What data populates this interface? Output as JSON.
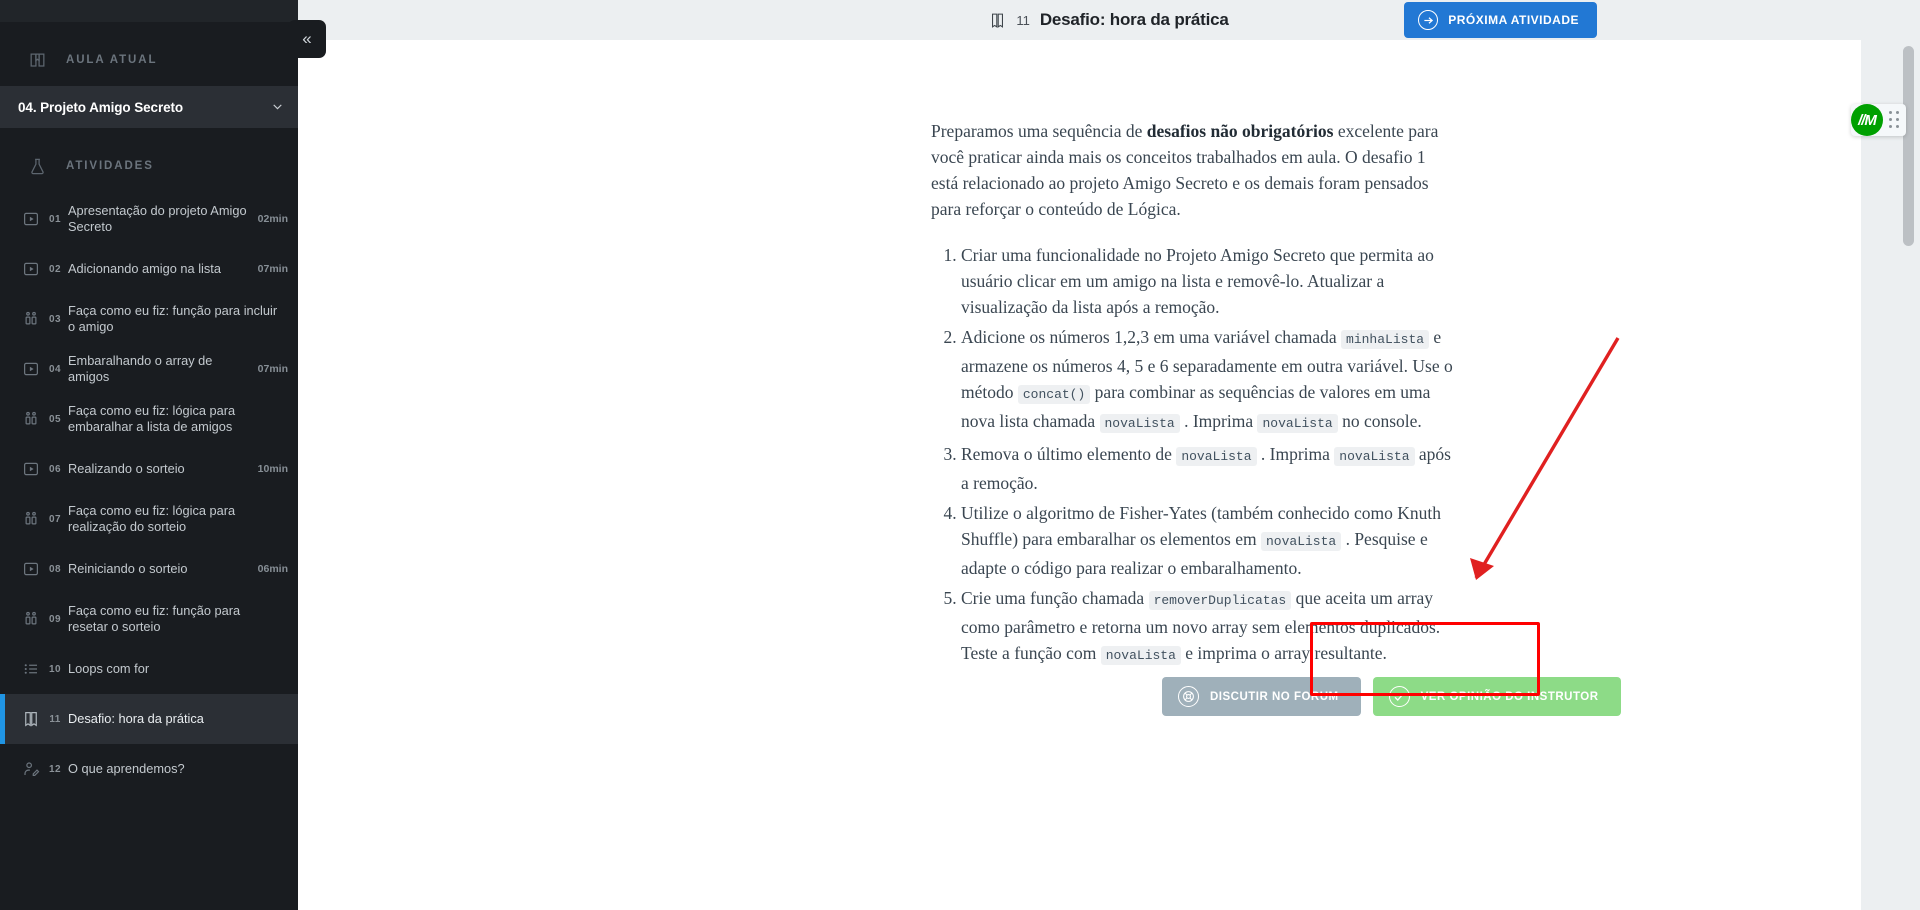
{
  "sidebar": {
    "current_class_section": {
      "icon": "book-icon",
      "title": "AULA ATUAL",
      "selected": "04. Projeto Amigo Secreto",
      "chevron": "⌄"
    },
    "activities_section": {
      "icon": "flask-icon",
      "title": "ATIVIDADES"
    },
    "activities": [
      {
        "num": "01",
        "label": "Apresentação do projeto Amigo Secreto",
        "duration": "02min",
        "icon": "video-icon",
        "active": false
      },
      {
        "num": "02",
        "label": "Adicionando amigo na lista",
        "duration": "07min",
        "icon": "video-icon",
        "active": false
      },
      {
        "num": "03",
        "label": "Faça como eu fiz: função para incluir o amigo",
        "duration": "",
        "icon": "people-icon",
        "active": false
      },
      {
        "num": "04",
        "label": "Embaralhando o array de amigos",
        "duration": "07min",
        "icon": "video-icon",
        "active": false
      },
      {
        "num": "05",
        "label": "Faça como eu fiz: lógica para embaralhar a lista de amigos",
        "duration": "",
        "icon": "people-icon",
        "active": false
      },
      {
        "num": "06",
        "label": "Realizando o sorteio",
        "duration": "10min",
        "icon": "video-icon",
        "active": false
      },
      {
        "num": "07",
        "label": "Faça como eu fiz: lógica para realização do sorteio",
        "duration": "",
        "icon": "people-icon",
        "active": false
      },
      {
        "num": "08",
        "label": "Reiniciando o sorteio",
        "duration": "06min",
        "icon": "video-icon",
        "active": false
      },
      {
        "num": "09",
        "label": "Faça como eu fiz: função para resetar o sorteio",
        "duration": "",
        "icon": "people-icon",
        "active": false
      },
      {
        "num": "10",
        "label": "Loops com for",
        "duration": "",
        "icon": "list-icon",
        "active": false
      },
      {
        "num": "11",
        "label": "Desafio: hora da prática",
        "duration": "",
        "icon": "book-open-icon",
        "active": true
      },
      {
        "num": "12",
        "label": "O que aprendemos?",
        "duration": "",
        "icon": "user-edit-icon",
        "active": false
      }
    ],
    "collapse_label": "«"
  },
  "topbar": {
    "icon": "book-open-icon",
    "number": "11",
    "title": "Desafio: hora da prática",
    "next_button": {
      "label": "PRÓXIMA ATIVIDADE",
      "icon": "arrow-right-circle-icon"
    }
  },
  "article": {
    "intro_part1": "Preparamos uma sequência de ",
    "intro_bold": "desafios não obrigatórios",
    "intro_part2": " excelente para você praticar ainda mais os conceitos trabalhados em aula. O desafio 1 está relacionado ao projeto Amigo Secreto e os demais foram pensados para reforçar o conteúdo de Lógica.",
    "items": [
      {
        "segments": [
          {
            "type": "text",
            "value": "Criar uma funcionalidade no Projeto Amigo Secreto que permita ao usuário clicar em um amigo na lista e removê-lo. Atualizar a visualização da lista após a remoção."
          }
        ]
      },
      {
        "segments": [
          {
            "type": "text",
            "value": "Adicione os números 1,2,3 em uma variável chamada "
          },
          {
            "type": "code",
            "value": "minhaLista"
          },
          {
            "type": "text",
            "value": " e armazene os números 4, 5 e 6 separadamente em outra variável. Use o método "
          },
          {
            "type": "code",
            "value": "concat()"
          },
          {
            "type": "text",
            "value": " para combinar as sequências de valores em uma nova lista chamada "
          },
          {
            "type": "code",
            "value": "novaLista"
          },
          {
            "type": "text",
            "value": " . Imprima "
          },
          {
            "type": "code",
            "value": "novaLista"
          },
          {
            "type": "text",
            "value": " no console."
          }
        ]
      },
      {
        "segments": [
          {
            "type": "text",
            "value": "Remova o último elemento de "
          },
          {
            "type": "code",
            "value": "novaLista"
          },
          {
            "type": "text",
            "value": " . Imprima "
          },
          {
            "type": "code",
            "value": "novaLista"
          },
          {
            "type": "text",
            "value": " após a remoção."
          }
        ]
      },
      {
        "segments": [
          {
            "type": "text",
            "value": "Utilize o algoritmo de Fisher-Yates (também conhecido como Knuth Shuffle) para embaralhar os elementos em "
          },
          {
            "type": "code",
            "value": "novaLista"
          },
          {
            "type": "text",
            "value": " . Pesquise e adapte o código para realizar o embaralhamento."
          }
        ]
      },
      {
        "segments": [
          {
            "type": "text",
            "value": "Crie uma função chamada "
          },
          {
            "type": "code",
            "value": "removerDuplicatas"
          },
          {
            "type": "text",
            "value": " que aceita um array como parâmetro e retorna um novo array sem elementos duplicados. Teste a função com "
          },
          {
            "type": "code",
            "value": "novaLista"
          },
          {
            "type": "text",
            "value": " e imprima o array resultante."
          }
        ]
      }
    ]
  },
  "actions": {
    "forum_button": {
      "label": "DISCUTIR NO FORUM",
      "icon": "lifebuoy-icon",
      "color": "#9fb0ba"
    },
    "opinion_button": {
      "label": "VER OPINIÃO DO INSTRUTOR",
      "icon": "check-circle-icon",
      "color": "#8ddb87"
    }
  },
  "floating_widget": {
    "badge_text": "//M",
    "badge_color": "#00a000",
    "drag_handle": "drag-dots-icon"
  },
  "annotation": {
    "box_color": "#ff0000",
    "arrow_color": "#e02020"
  }
}
